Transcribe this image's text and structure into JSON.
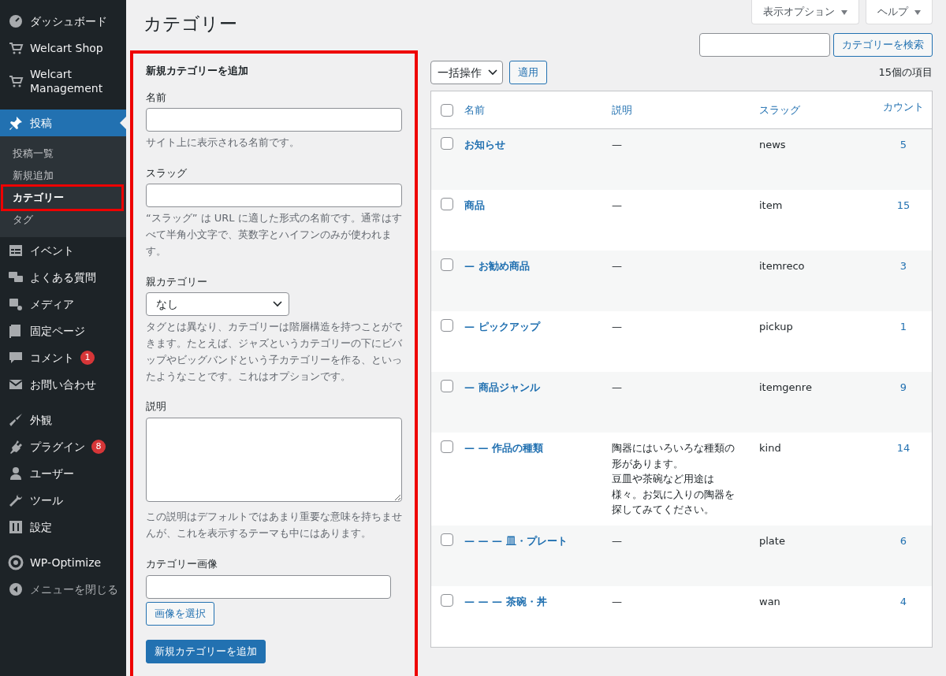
{
  "sidebar": {
    "groups": [
      [
        {
          "label": "ダッシュボード",
          "kind": "item",
          "selected": false
        },
        {
          "label": "Welcart Shop",
          "kind": "item",
          "selected": false
        },
        {
          "label": "Welcart Management",
          "kind": "item",
          "selected": false
        }
      ],
      [
        {
          "label": "投稿",
          "kind": "item",
          "selected": true,
          "children": [
            {
              "label": "投稿一覧",
              "selected": false,
              "highlighted": false
            },
            {
              "label": "新規追加",
              "selected": false,
              "highlighted": false
            },
            {
              "label": "カテゴリー",
              "selected": true,
              "highlighted": true
            },
            {
              "label": "タグ",
              "selected": false,
              "highlighted": false
            }
          ]
        },
        {
          "label": "イベント",
          "kind": "item",
          "selected": false
        },
        {
          "label": "よくある質問",
          "kind": "item",
          "selected": false
        },
        {
          "label": "メディア",
          "kind": "item",
          "selected": false
        },
        {
          "label": "固定ページ",
          "kind": "item",
          "selected": false
        },
        {
          "label": "コメント",
          "kind": "item",
          "selected": false,
          "badge": "1"
        },
        {
          "label": "お問い合わせ",
          "kind": "item",
          "selected": false
        }
      ],
      [
        {
          "label": "外観",
          "kind": "item",
          "selected": false
        },
        {
          "label": "プラグイン",
          "kind": "item",
          "selected": false,
          "badge": "8"
        },
        {
          "label": "ユーザー",
          "kind": "item",
          "selected": false
        },
        {
          "label": "ツール",
          "kind": "item",
          "selected": false
        },
        {
          "label": "設定",
          "kind": "item",
          "selected": false
        }
      ],
      [
        {
          "label": "WP-Optimize",
          "kind": "item",
          "selected": false
        },
        {
          "label": "メニューを閉じる",
          "kind": "collapse",
          "selected": false
        }
      ]
    ]
  },
  "page_title": "カテゴリー",
  "screen_tabs": [
    {
      "label": "表示オプション",
      "expanded": false
    },
    {
      "label": "ヘルプ",
      "expanded": false
    }
  ],
  "search": {
    "button": "カテゴリーを検索"
  },
  "add_form": {
    "highlighted": true,
    "heading": "新規カテゴリーを追加",
    "fields": [
      {
        "kind": "text",
        "label": "名前",
        "help": "サイト上に表示される名前です。"
      },
      {
        "kind": "text",
        "label": "スラッグ",
        "help": "“スラッグ” は URL に適した形式の名前です。通常はすべて半角小文字で、英数字とハイフンのみが使われます。"
      },
      {
        "kind": "select",
        "label": "親カテゴリー",
        "value": "なし",
        "help": "タグとは異なり、カテゴリーは階層構造を持つことができます。たとえば、ジャズというカテゴリーの下にビバップやビッグバンドという子カテゴリーを作る、といったようなことです。これはオプションです。"
      },
      {
        "kind": "textarea",
        "label": "説明",
        "help": "この説明はデフォルトではあまり重要な意味を持ちませんが、これを表示するテーマも中にはあります。"
      },
      {
        "kind": "image",
        "label": "カテゴリー画像",
        "button": "画像を選択"
      }
    ],
    "submit": "新規カテゴリーを追加"
  },
  "bulk": {
    "select": "一括操作",
    "apply": "適用",
    "count": "15個の項目"
  },
  "table": {
    "select_all_checked": false,
    "columns": [
      "名前",
      "説明",
      "スラッグ",
      "カウント"
    ],
    "rows": [
      {
        "name": "お知らせ",
        "description": "—",
        "slug": "news",
        "count": "5",
        "checked": false
      },
      {
        "name": "商品",
        "description": "—",
        "slug": "item",
        "count": "15",
        "checked": false
      },
      {
        "name": "— お勧め商品",
        "description": "—",
        "slug": "itemreco",
        "count": "3",
        "checked": false
      },
      {
        "name": "— ピックアップ",
        "description": "—",
        "slug": "pickup",
        "count": "1",
        "checked": false
      },
      {
        "name": "— 商品ジャンル",
        "description": "—",
        "slug": "itemgenre",
        "count": "9",
        "checked": false
      },
      {
        "name": "— — 作品の種類",
        "description": [
          "陶器にはいろいろな種類の形があります。",
          "豆皿や茶碗など用途は様々。お気に入りの陶器を探してみてください。"
        ],
        "slug": "kind",
        "count": "14",
        "checked": false
      },
      {
        "name": "— — — 皿・プレート",
        "description": "—",
        "slug": "plate",
        "count": "6",
        "checked": false
      },
      {
        "name": "— — — 茶碗・丼",
        "description": "—",
        "slug": "wan",
        "count": "4",
        "checked": false
      }
    ]
  }
}
